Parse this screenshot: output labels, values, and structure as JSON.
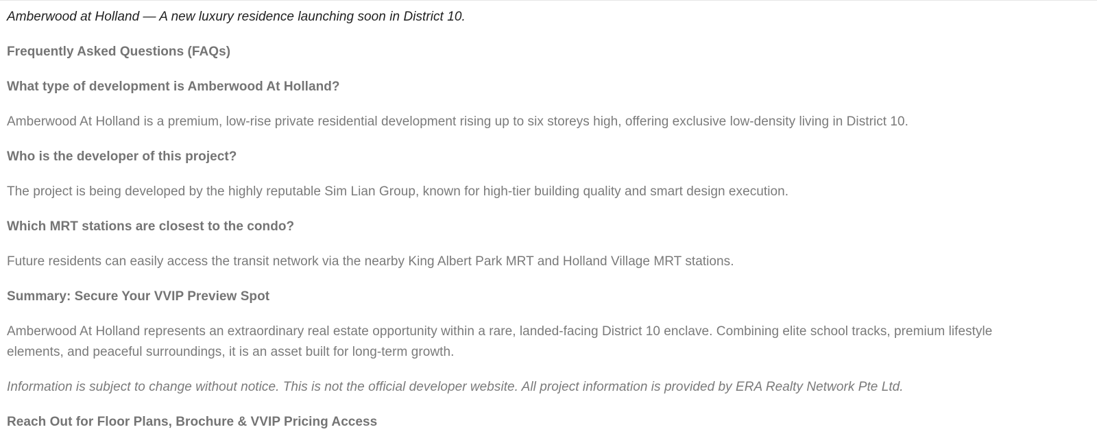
{
  "intro": "Amberwood at Holland — A new luxury residence launching soon in District 10.",
  "faq_heading": "Frequently Asked Questions (FAQs)",
  "faqs": [
    {
      "question": "What type of development is Amberwood At Holland?",
      "answer": "Amberwood At Holland is a premium, low-rise private residential development rising up to six storeys high, offering exclusive low-density living in District 10."
    },
    {
      "question": "Who is the developer of this project?",
      "answer": "The project is being developed by the highly reputable Sim Lian Group, known for high-tier building quality and smart design execution."
    },
    {
      "question": "Which MRT stations are closest to the condo?",
      "answer": "Future residents can easily access the transit network via the nearby King Albert Park MRT and Holland Village MRT stations."
    }
  ],
  "summary": {
    "heading": "Summary: Secure Your VVIP Preview Spot",
    "text": "Amberwood At Holland represents an extraordinary real estate opportunity within a rare, landed-facing District 10 enclave. Combining elite school tracks, premium lifestyle elements, and peaceful surroundings, it is an asset built for long-term growth."
  },
  "disclaimer": "Information is subject to change without notice. This is not the official developer website. All project information is provided by ERA Realty Network Pte Ltd.",
  "cta_heading": "Reach Out for Floor Plans, Brochure & VVIP Pricing Access"
}
